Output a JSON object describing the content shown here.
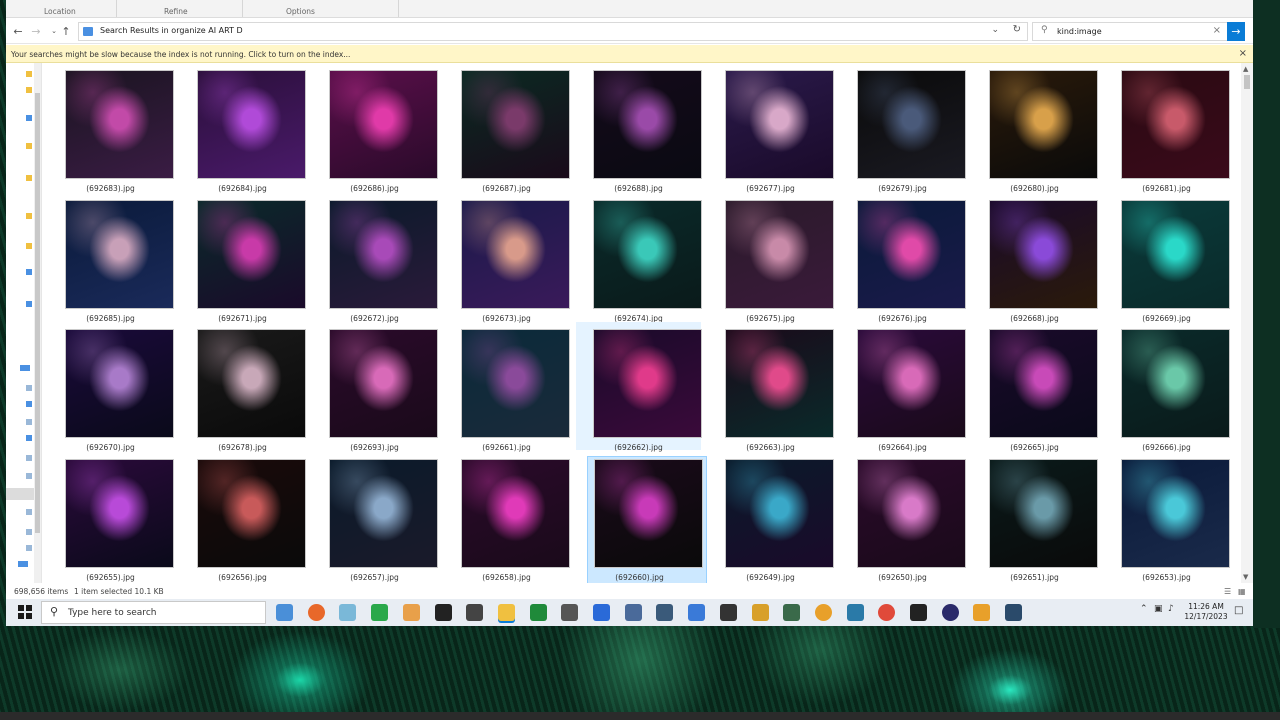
{
  "ribbon": {
    "groups": [
      "Location",
      "Refine",
      "Options"
    ]
  },
  "address": {
    "path": "Search Results in organize AI ART D",
    "back": "←",
    "forward": "→",
    "up": "↑",
    "dropdown": "⌄",
    "refresh": "↻"
  },
  "search": {
    "query": "kind:image",
    "clear": "×",
    "go": "→"
  },
  "infobar": {
    "message": "Your searches might be slow because the index is not running.  Click to turn on the index...",
    "close": "×"
  },
  "files": [
    {
      "name": "(692683).jpg",
      "colors": [
        "#1a1420",
        "#c24aa8",
        "#3a1c44"
      ]
    },
    {
      "name": "(692684).jpg",
      "colors": [
        "#2a0f3a",
        "#b04ad8",
        "#4a1a6a"
      ]
    },
    {
      "name": "(692686).jpg",
      "colors": [
        "#5a0f4a",
        "#e03aa8",
        "#2a0a2a"
      ]
    },
    {
      "name": "(692687).jpg",
      "colors": [
        "#0a2a22",
        "#7a3a6a",
        "#1a0a1a"
      ]
    },
    {
      "name": "(692688).jpg",
      "colors": [
        "#140a1a",
        "#9a4aa8",
        "#0a0a12"
      ]
    },
    {
      "name": "(692677).jpg",
      "colors": [
        "#2a1a4a",
        "#d8a8c8",
        "#1a0a2a"
      ]
    },
    {
      "name": "(692679).jpg",
      "colors": [
        "#0a0a0a",
        "#4a5a7a",
        "#1a1a22"
      ]
    },
    {
      "name": "(692680).jpg",
      "colors": [
        "#2a1a0a",
        "#d8a04a",
        "#0a0a0a"
      ]
    },
    {
      "name": "(692681).jpg",
      "colors": [
        "#2a0a12",
        "#c85a6a",
        "#3a0a1a"
      ]
    },
    {
      "name": "(692685).jpg",
      "colors": [
        "#0a1a3a",
        "#c8a0b8",
        "#1a2a5a"
      ]
    },
    {
      "name": "(692671).jpg",
      "colors": [
        "#0a2a2a",
        "#c83aa8",
        "#1a0a2a"
      ]
    },
    {
      "name": "(692672).jpg",
      "colors": [
        "#0a1a2a",
        "#a84ab8",
        "#2a1a3a"
      ]
    },
    {
      "name": "(692673).jpg",
      "colors": [
        "#1a1a4a",
        "#d89a8a",
        "#3a1a5a"
      ]
    },
    {
      "name": "(692674).jpg",
      "colors": [
        "#0a2a2a",
        "#3ac8b8",
        "#0a1a1a"
      ]
    },
    {
      "name": "(692675).jpg",
      "colors": [
        "#2a1a2a",
        "#c88aa8",
        "#3a1a3a"
      ]
    },
    {
      "name": "(692676).jpg",
      "colors": [
        "#0a1a3a",
        "#e04aa8",
        "#1a1a4a"
      ]
    },
    {
      "name": "(692668).jpg",
      "colors": [
        "#1a0a2a",
        "#8a4ad8",
        "#2a1a0a"
      ]
    },
    {
      "name": "(692669).jpg",
      "colors": [
        "#0a3a3a",
        "#2ad8c8",
        "#0a2a2a"
      ]
    },
    {
      "name": "(692670).jpg",
      "colors": [
        "#1a0a3a",
        "#a87ac8",
        "#0a0a1a"
      ]
    },
    {
      "name": "(692678).jpg",
      "colors": [
        "#1a1a1a",
        "#c8a8b8",
        "#0a0a0a"
      ]
    },
    {
      "name": "(692693).jpg",
      "colors": [
        "#2a0a2a",
        "#d86ab8",
        "#1a0a1a"
      ]
    },
    {
      "name": "(692661).jpg",
      "colors": [
        "#0a2a3a",
        "#8a4a9a",
        "#1a2a3a"
      ]
    },
    {
      "name": "(692662).jpg",
      "colors": [
        "#1a0a2a",
        "#e03a8a",
        "#3a0a3a"
      ]
    },
    {
      "name": "(692663).jpg",
      "colors": [
        "#1a0a1a",
        "#e04a8a",
        "#0a2a2a"
      ]
    },
    {
      "name": "(692664).jpg",
      "colors": [
        "#2a0a3a",
        "#d86ab8",
        "#1a0a1a"
      ]
    },
    {
      "name": "(692665).jpg",
      "colors": [
        "#1a0a2a",
        "#c84ab8",
        "#0a0a1a"
      ]
    },
    {
      "name": "(692666).jpg",
      "colors": [
        "#0a2a2a",
        "#6ac8a8",
        "#0a1a1a"
      ]
    },
    {
      "name": "(692655).jpg",
      "colors": [
        "#2a0a3a",
        "#b84ad8",
        "#0a0a1a"
      ]
    },
    {
      "name": "(692656).jpg",
      "colors": [
        "#1a0a0a",
        "#c85a5a",
        "#0a0a0a"
      ]
    },
    {
      "name": "(692657).jpg",
      "colors": [
        "#0a1a2a",
        "#8aa8c8",
        "#1a1a2a"
      ]
    },
    {
      "name": "(692658).jpg",
      "colors": [
        "#2a0a2a",
        "#e03ab8",
        "#1a0a1a"
      ]
    },
    {
      "name": "(692660).jpg",
      "colors": [
        "#1a0a1a",
        "#c83ab8",
        "#0a0a0a"
      ]
    },
    {
      "name": "(692649).jpg",
      "colors": [
        "#0a1a2a",
        "#3aa8c8",
        "#1a0a2a"
      ]
    },
    {
      "name": "(692650).jpg",
      "colors": [
        "#2a0a2a",
        "#d87ac8",
        "#1a0a1a"
      ]
    },
    {
      "name": "(692651).jpg",
      "colors": [
        "#0a1a1a",
        "#6a9aa8",
        "#0a0a0a"
      ]
    },
    {
      "name": "(692653).jpg",
      "colors": [
        "#0a1a3a",
        "#4ac8d8",
        "#1a2a4a"
      ]
    }
  ],
  "selected_file": "(692660).jpg",
  "hover_file": "(692662).jpg",
  "status": {
    "count": "698,656 items",
    "selection": "1 item selected  10.1 KB"
  },
  "taskbar": {
    "search_placeholder": "Type here to search",
    "time": "11:26 AM",
    "date": "12/17/2023",
    "apps": [
      {
        "name": "files-app-icon",
        "color": "#4a8fd8"
      },
      {
        "name": "firefox-icon",
        "color": "#e8682a"
      },
      {
        "name": "notepad-icon",
        "color": "#7ab8d8"
      },
      {
        "name": "green-app-icon",
        "color": "#2aa84a"
      },
      {
        "name": "media-app-icon",
        "color": "#e8a04a"
      },
      {
        "name": "terminal-icon",
        "color": "#222222"
      },
      {
        "name": "obs-icon",
        "color": "#444444"
      },
      {
        "name": "file-explorer-icon",
        "color": "#f0c040"
      },
      {
        "name": "excel-icon",
        "color": "#1f8a3a"
      },
      {
        "name": "unity-icon",
        "color": "#555555"
      },
      {
        "name": "blue-square-icon",
        "color": "#2a6ad8"
      },
      {
        "name": "network-icon",
        "color": "#4a6a9a"
      },
      {
        "name": "calculator-icon",
        "color": "#3a5a7a"
      },
      {
        "name": "translate-icon",
        "color": "#3a7ad8"
      },
      {
        "name": "text-app-icon",
        "color": "#333333"
      },
      {
        "name": "pen-app-icon",
        "color": "#d8a02a"
      },
      {
        "name": "shield-app-icon",
        "color": "#3a6a4a"
      },
      {
        "name": "headset-icon",
        "color": "#e8a02a"
      },
      {
        "name": "camera-icon",
        "color": "#2a7aa8"
      },
      {
        "name": "chrome-icon",
        "color": "#e04a3a"
      },
      {
        "name": "qr-app-icon",
        "color": "#222222"
      },
      {
        "name": "disk-app-icon",
        "color": "#2a2a6a"
      },
      {
        "name": "triangle-app-icon",
        "color": "#e8a02a"
      },
      {
        "name": "photo-app-icon",
        "color": "#2a4a6a"
      }
    ],
    "tray": [
      "⌃",
      "▣",
      "♪"
    ]
  }
}
